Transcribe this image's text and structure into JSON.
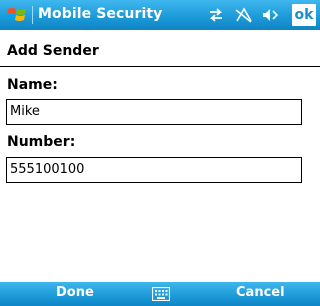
{
  "titlebar": {
    "logo_icon": "windows-flag-icon",
    "title": "Mobile Security",
    "status_icons": [
      "connectivity-icon",
      "signal-off-icon",
      "volume-icon"
    ],
    "ok_label": "ok",
    "colors": {
      "bar": "#1d9bd9",
      "ok_text": "#1a8fd0"
    }
  },
  "page": {
    "heading": "Add Sender",
    "name_label": "Name:",
    "name_value": "Mike",
    "number_label": "Number:",
    "number_value": "555100100"
  },
  "softkeys": {
    "left_label": "Done",
    "center_icon": "keyboard-icon",
    "right_label": "Cancel"
  }
}
